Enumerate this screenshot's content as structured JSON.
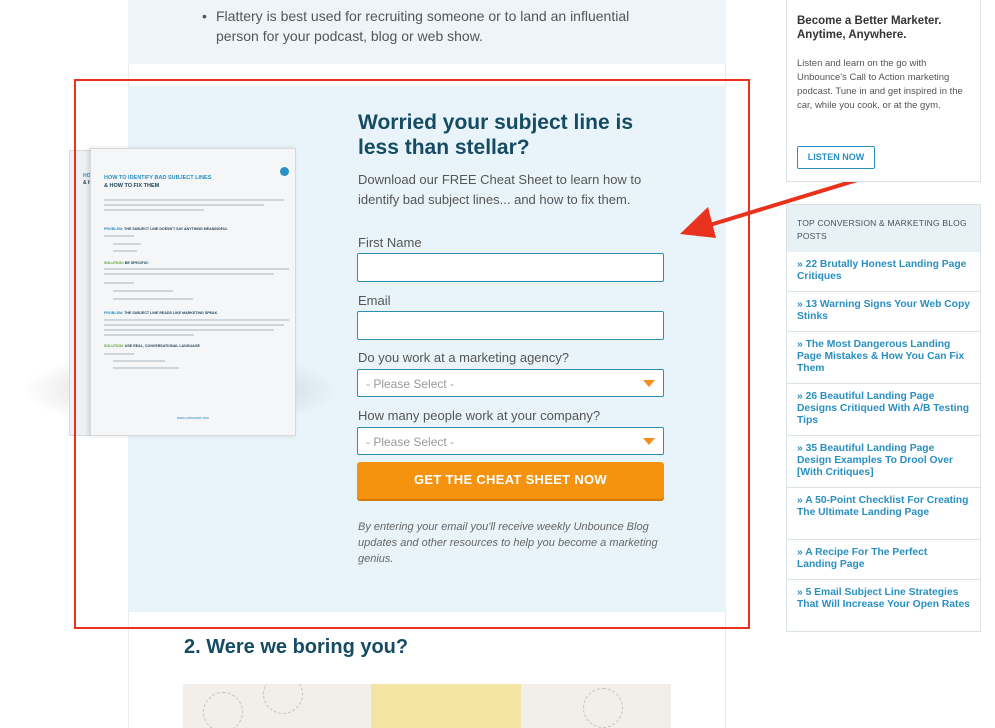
{
  "article": {
    "bullet_text": "Flattery is best used for recruiting someone or to land an influential person for your podcast, blog or web show.",
    "section_heading": "2. Were we boring you?"
  },
  "cta": {
    "title": "Worried your subject line is less than stellar?",
    "description": "Download our FREE Cheat Sheet to learn how to identify bad subject lines... and how to fix them.",
    "first_name_label": "First Name",
    "first_name_value": "",
    "email_label": "Email",
    "email_value": "",
    "agency_label": "Do you work at a marketing agency?",
    "agency_selected": "- Please Select -",
    "company_size_label": "How many people work at your company?",
    "company_size_selected": "- Please Select -",
    "submit_label": "GET THE CHEAT SHEET NOW",
    "disclaimer": "By entering your email you'll receive weekly Unbounce Blog updates and other resources to help you become a marketing genius."
  },
  "cheat_sheet": {
    "title_line1": "HOW TO IDENTIFY BAD SUBJECT LINES",
    "title_line2": "& HOW TO FIX THEM",
    "problem1_tag": "PROBLEM:",
    "problem1_text": "THE SUBJECT LINE DOESN'T SAY ANYTHING MEANINGFUL",
    "solution1_tag": "SOLUTION:",
    "solution1_text": "BE SPECIFIC!",
    "problem2_tag": "PROBLEM:",
    "problem2_text": "THE SUBJECT LINE READS LIKE MARKETING SPEAK",
    "solution2_tag": "SOLUTION:",
    "solution2_text": "USE REAL, CONVERSATIONAL LANGUAGE",
    "footer_url": "www.unbounce.com"
  },
  "sidebar": {
    "podcast_title": "Become a Better Marketer. Anytime, Anywhere.",
    "podcast_body": "Listen and learn on the go with Unbounce's Call to Action marketing podcast. Tune in and get inspired in the car, while you cook, or at the gym.",
    "listen_label": "LISTEN NOW",
    "posts_header": "TOP CONVERSION & MARKETING BLOG POSTS",
    "posts": [
      "» 22 Brutally Honest Landing Page Critiques",
      "» 13 Warning Signs Your Web Copy Stinks",
      "» The Most Dangerous Landing Page Mistakes & How You Can Fix Them",
      "» 26 Beautiful Landing Page Designs Critiqued With A/B Testing Tips",
      "» 35 Beautiful Landing Page Design Examples To Drool Over [With Critiques]",
      "» A 50-Point Checklist For Creating The Ultimate Landing Page",
      "» A Recipe For The Perfect Landing Page",
      "» 5 Email Subject Line Strategies That Will Increase Your Open Rates"
    ]
  },
  "colors": {
    "accent_orange": "#f5930f",
    "link_blue": "#2a8fc1",
    "heading_navy": "#154b63",
    "annotation_red": "#e8321d"
  }
}
